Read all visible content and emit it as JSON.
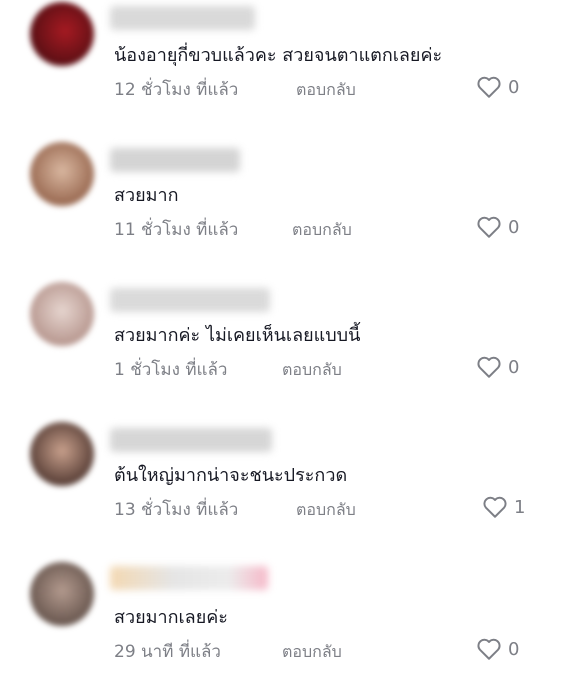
{
  "comments": [
    {
      "text": "น้องอายุกี่ขวบแล้วคะ สวยจนตาแตกเลยค่ะ",
      "time": "12 ชั่วโมง ที่แล้ว",
      "reply": "ตอบกลับ",
      "likes": "0"
    },
    {
      "text": "สวยมาก",
      "time": "11 ชั่วโมง ที่แล้ว",
      "reply": "ตอบกลับ",
      "likes": "0"
    },
    {
      "text": "สวยมากค่ะ ไม่เคยเห็นเลยแบบนี้",
      "time": "1 ชั่วโมง ที่แล้ว",
      "reply": "ตอบกลับ",
      "likes": "0"
    },
    {
      "text": "ต้นใหญ่มากน่าจะชนะประกวด",
      "time": "13 ชั่วโมง ที่แล้ว",
      "reply": "ตอบกลับ",
      "likes": "1"
    },
    {
      "text": "สวยมากเลยค่ะ",
      "time": "29 นาที ที่แล้ว",
      "reply": "ตอบกลับ",
      "likes": "0"
    }
  ],
  "colors": {
    "text": "#161823",
    "meta": "#7d7f86"
  },
  "icons": {
    "like": "heart-outline-icon",
    "avatar": "user-avatar-blurred"
  }
}
